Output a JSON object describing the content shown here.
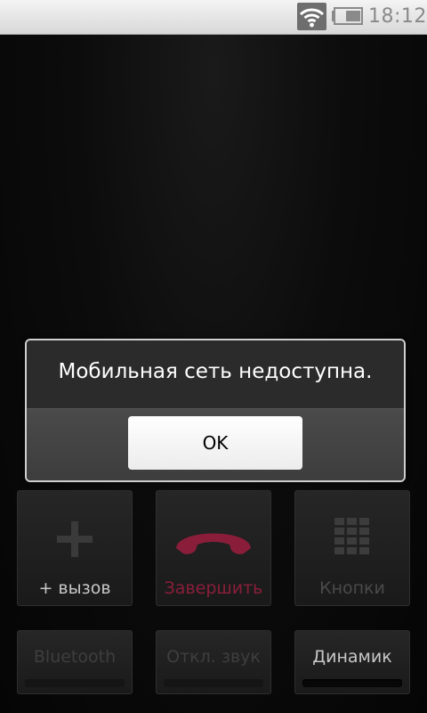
{
  "status_bar": {
    "time": "18:12",
    "wifi_icon": "wifi-icon",
    "battery_icon": "battery-icon",
    "battery_level_fraction": 0.55
  },
  "dialog": {
    "message": "Мобильная сеть недоступна.",
    "ok_label": "OK"
  },
  "call_controls": {
    "add_call_label": "+ вызов",
    "end_call_label": "Завершить",
    "keypad_label": "Кнопки",
    "bluetooth_label": "Bluetooth",
    "mute_label": "Откл. звук",
    "speaker_label": "Динамик"
  },
  "colors": {
    "end_call": "#8a1e3a",
    "disabled_text": "#4a4a4a",
    "enabled_text": "#c8c8c8"
  }
}
